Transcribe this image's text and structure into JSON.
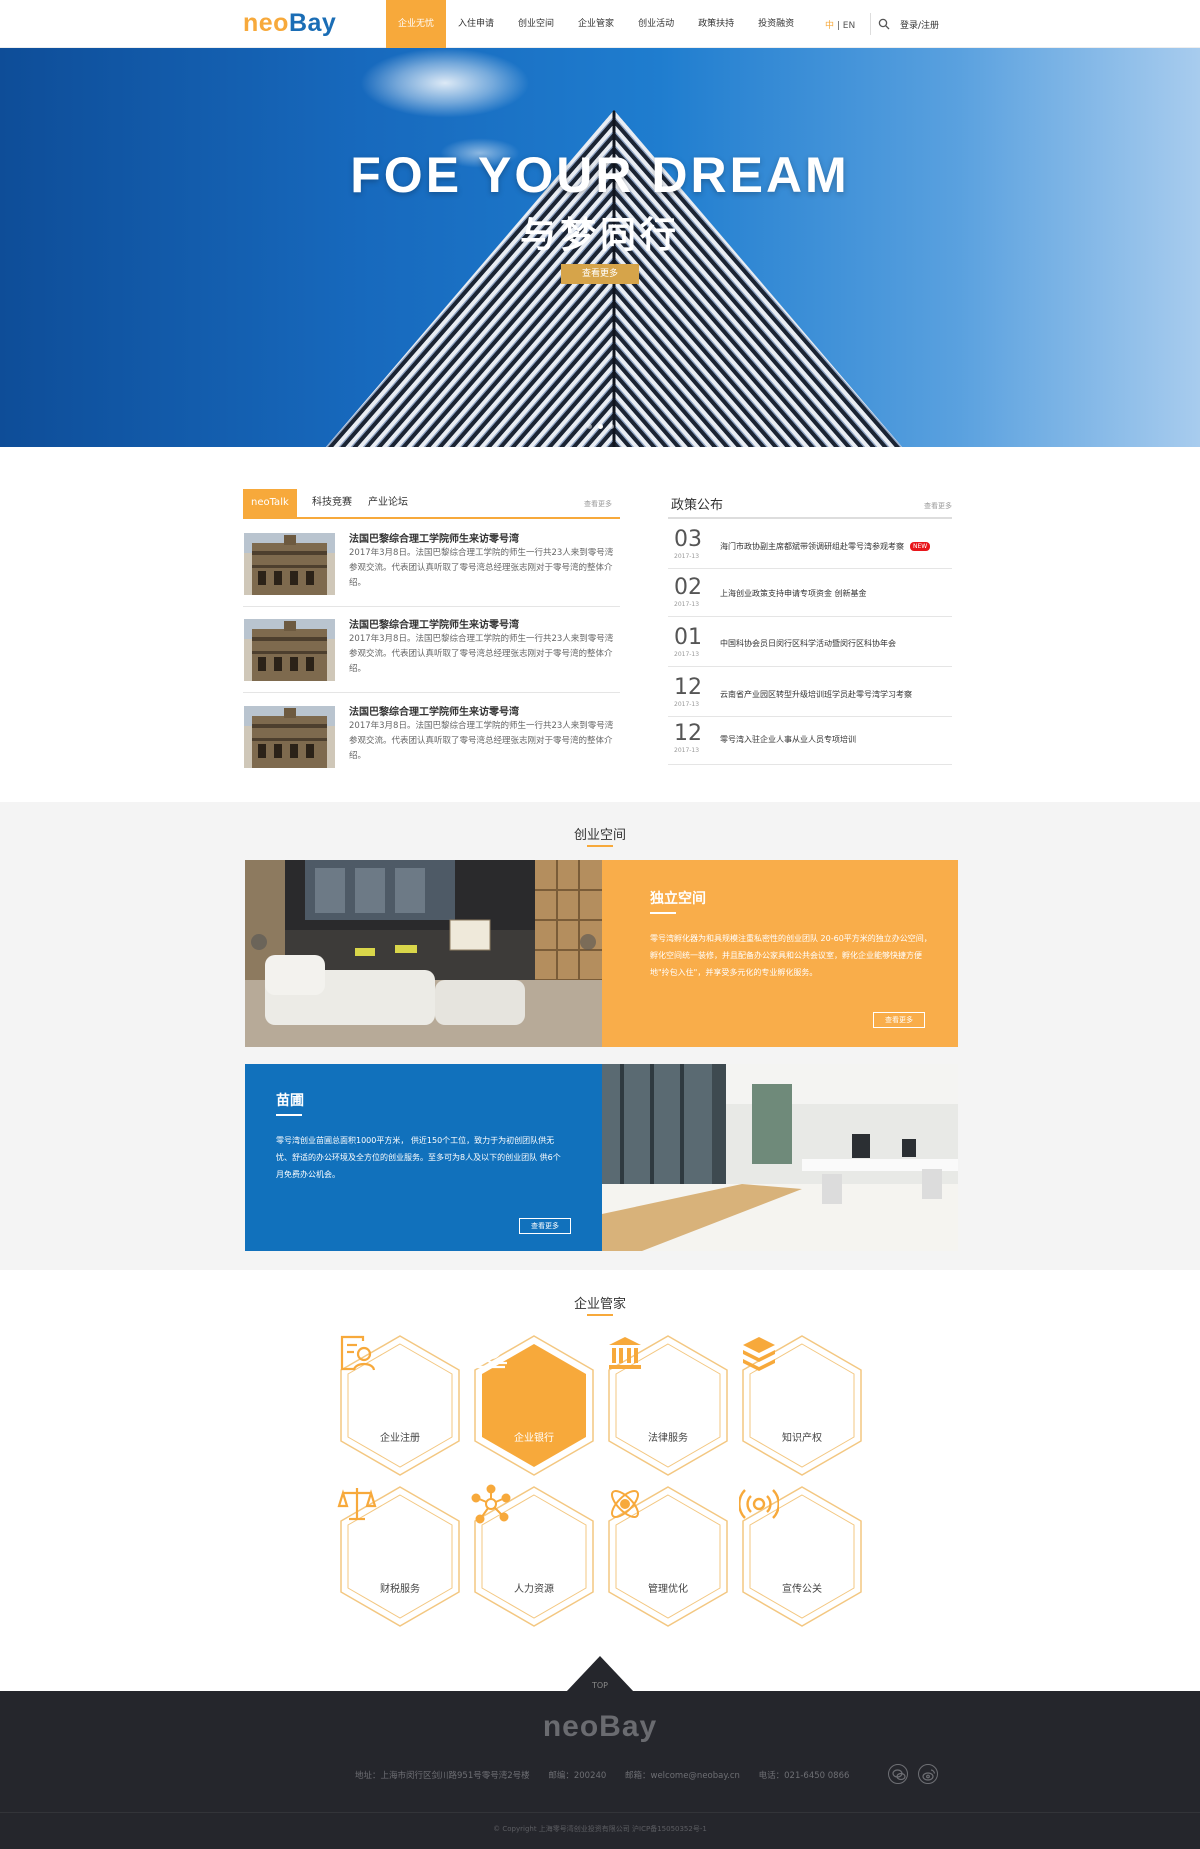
{
  "header": {
    "logo_neo": "neo",
    "logo_bay": "Bay",
    "nav": [
      "企业无忧",
      "入住申请",
      "创业空间",
      "企业管家",
      "创业活动",
      "政策扶持",
      "投资融资"
    ],
    "lang_zh": "中",
    "lang_sep": " | ",
    "lang_en": "EN",
    "login": "登录/注册"
  },
  "banner": {
    "title": "FOE YOUR DREAM",
    "subtitle": "与梦同行",
    "button": "查看更多"
  },
  "news": {
    "tabs": [
      "neoTalk",
      "科技竞赛",
      "产业论坛"
    ],
    "more": "查看更多",
    "items": [
      {
        "title": "法国巴黎综合理工学院师生来访零号湾",
        "desc": "2017年3月8日。法国巴黎综合理工学院的师生一行共23人来到零号湾参观交流。代表团认真听取了零号湾总经理张志刚对于零号湾的整体介绍。"
      },
      {
        "title": "法国巴黎综合理工学院师生来访零号湾",
        "desc": "2017年3月8日。法国巴黎综合理工学院的师生一行共23人来到零号湾参观交流。代表团认真听取了零号湾总经理张志刚对于零号湾的整体介绍。"
      },
      {
        "title": "法国巴黎综合理工学院师生来访零号湾",
        "desc": "2017年3月8日。法国巴黎综合理工学院的师生一行共23人来到零号湾参观交流。代表团认真听取了零号湾总经理张志刚对于零号湾的整体介绍。"
      }
    ]
  },
  "policy": {
    "title": "政策公布",
    "more": "查看更多",
    "new_badge": "NEW",
    "items": [
      {
        "day": "03",
        "date": "2017-13",
        "text": "海门市政协副主席都斌带领调研组赴零号湾参观考察"
      },
      {
        "day": "02",
        "date": "2017-13",
        "text": "上海创业政策支持申请专项资金 创新基金"
      },
      {
        "day": "01",
        "date": "2017-13",
        "text": "中国科协会员日闵行区科学活动暨闵行区科协年会"
      },
      {
        "day": "12",
        "date": "2017-13",
        "text": "云南省产业园区转型升级培训班学员赴零号湾学习考察"
      },
      {
        "day": "12",
        "date": "2017-13",
        "text": "零号湾入驻企业人事从业人员专项培训"
      }
    ]
  },
  "space": {
    "title": "创业空间",
    "independent": {
      "heading": "独立空间",
      "text": "零号湾孵化器为和具规模注重私密性的创业团队 20-60平方米的独立办公空间，孵化空间统一装修，并且配备办公家具和公共会议室，孵化企业能够快捷方便地\"拎包入住\"，并享受多元化的专业孵化服务。",
      "button": "查看更多"
    },
    "nursery": {
      "heading": "苗圃",
      "text": "零号湾创业苗圃总面积1000平方米， 供近150个工位，致力于为初创团队供无忧、舒适的办公环境及全方位的创业服务。至多可为8人及以下的创业团队 供6个月免费办公机会。",
      "button": "查看更多"
    }
  },
  "butler": {
    "title": "企业管家",
    "services": [
      {
        "label": "企业注册",
        "icon": "registration-icon"
      },
      {
        "label": "企业银行",
        "icon": "bank-icon"
      },
      {
        "label": "法律服务",
        "icon": "courthouse-icon"
      },
      {
        "label": "知识产权",
        "icon": "stack-icon"
      },
      {
        "label": "财税服务",
        "icon": "scales-icon"
      },
      {
        "label": "人力资源",
        "icon": "network-icon"
      },
      {
        "label": "管理优化",
        "icon": "atom-icon"
      },
      {
        "label": "宣传公关",
        "icon": "broadcast-icon"
      }
    ]
  },
  "footer": {
    "top_label": "TOP",
    "logo": "neoBay",
    "address": "地址：上海市闵行区剑川路951号零号湾2号楼",
    "postcode": "邮编：200240",
    "email": "邮箱：welcome@neobay.cn",
    "phone": "电话：021-6450 0866",
    "copyright": "© Copyright 上海零号湾创业投资有限公司 沪ICP备15050352号-1"
  },
  "colors": {
    "accent": "#f7a93b",
    "brand_blue": "#1a6db5",
    "footer": "#25262c"
  }
}
